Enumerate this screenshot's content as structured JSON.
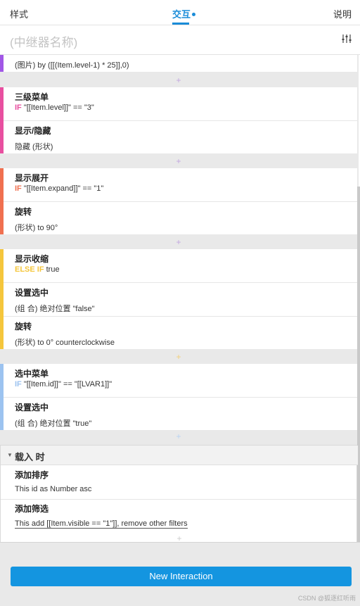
{
  "tabs": {
    "style": "样式",
    "interactions": "交互",
    "notes": "说明"
  },
  "name_placeholder": "(中继器名称)",
  "colors": {
    "accent": "#1a8cd8",
    "purple": "#a157e6",
    "pink": "#e84fa0",
    "orange": "#f07050",
    "yellow": "#f5c63c",
    "blue": "#9cc3f0",
    "button": "#1495e0"
  },
  "partial_top": {
    "value": "(图片) by ([[(Item.level-1) * 25]],0)"
  },
  "cases": [
    {
      "title": "三级菜单",
      "kw": "IF",
      "condition": " \"[[Item.level]]\" == \"3\"",
      "actions": [
        {
          "title": "显示/隐藏",
          "value": "隐藏 (形状)"
        }
      ]
    },
    {
      "title": "显示展开",
      "kw": "IF",
      "condition": " \"[[Item.expand]]\" == \"1\"",
      "actions": [
        {
          "title": "旋转",
          "value": "(形状) to 90°"
        }
      ]
    },
    {
      "title": "显示收缩",
      "kw": "ELSE IF",
      "condition": " true",
      "actions": [
        {
          "title": "设置选中",
          "value": "(组 合) 绝对位置 \"false\""
        },
        {
          "title": "旋转",
          "value": "(形状) to 0° counterclockwise"
        }
      ]
    },
    {
      "title": "选中菜单",
      "kw": "IF",
      "condition": " \"[[Item.id]]\" == \"[[LVAR1]]\"",
      "actions": [
        {
          "title": "设置选中",
          "value": "(组 合) 绝对位置 \"true\""
        }
      ]
    }
  ],
  "plus": "+",
  "load_group": {
    "label": "载入 时",
    "actions": [
      {
        "title": "添加排序",
        "value": "This id as Number asc"
      },
      {
        "title": "添加筛选",
        "value": "This add [[Item.visible == \"1\"]], remove other filters"
      }
    ]
  },
  "new_interaction": "New Interaction",
  "watermark": "CSDN @狐逐红听雨"
}
